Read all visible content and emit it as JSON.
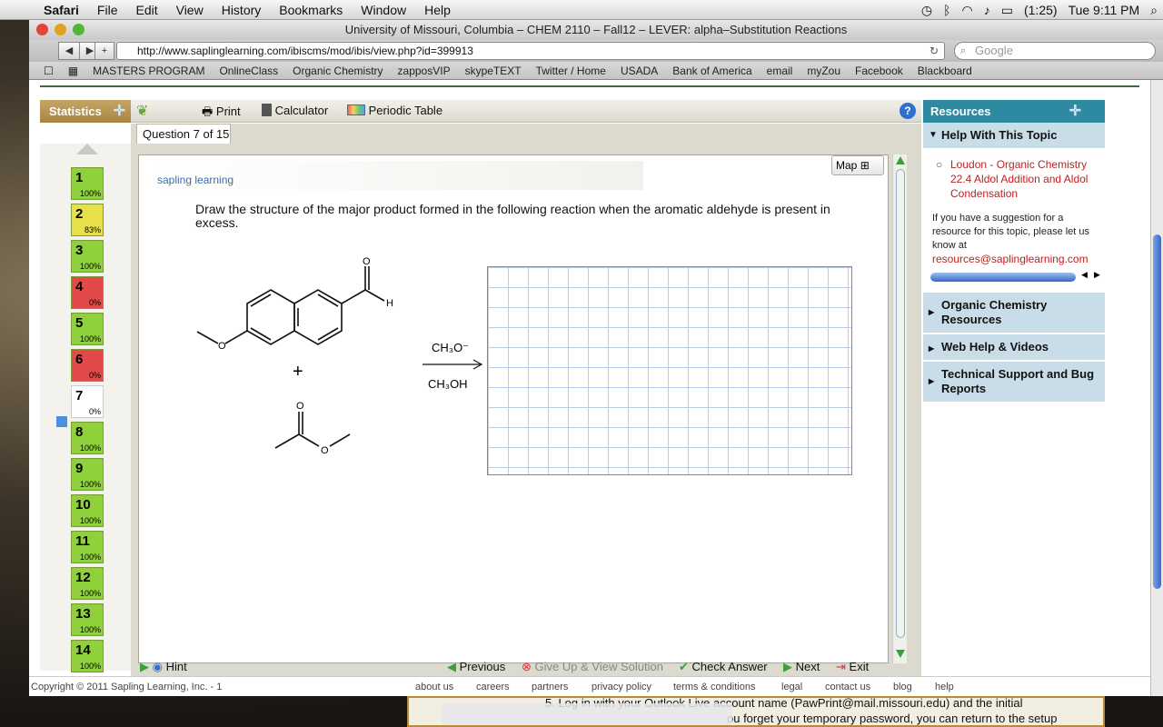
{
  "menubar": {
    "app": "Safari",
    "items": [
      "File",
      "Edit",
      "View",
      "History",
      "Bookmarks",
      "Window",
      "Help"
    ],
    "battery": "(1:25)",
    "clock": "Tue 9:11 PM"
  },
  "window": {
    "title": "University of Missouri, Columbia – CHEM 2110 – Fall12 – LEVER: alpha–Substitution Reactions",
    "url": "http://www.saplinglearning.com/ibiscms/mod/ibis/view.php?id=399913",
    "search_placeholder": "Google"
  },
  "bookmarks": [
    "MASTERS PROGRAM",
    "OnlineClass",
    "Organic Chemistry",
    "zapposVIP",
    "skypeTEXT",
    "Twitter / Home",
    "USADA",
    "Bank of America",
    "email",
    "myZou",
    "Facebook",
    "Blackboard"
  ],
  "app_toolbar": {
    "statistics": "Statistics",
    "print": "Print",
    "calculator": "Calculator",
    "periodic_table": "Periodic Table"
  },
  "question_tab": "Question 7 of 15",
  "questions": [
    {
      "n": "1",
      "pct": "100%",
      "color": "#8ed13a"
    },
    {
      "n": "2",
      "pct": "83%",
      "color": "#e8e04a"
    },
    {
      "n": "3",
      "pct": "100%",
      "color": "#8ed13a"
    },
    {
      "n": "4",
      "pct": "0%",
      "color": "#e24a4a"
    },
    {
      "n": "5",
      "pct": "100%",
      "color": "#8ed13a"
    },
    {
      "n": "6",
      "pct": "0%",
      "color": "#e24a4a"
    },
    {
      "n": "7",
      "pct": "0%",
      "color": "#ffffff"
    },
    {
      "n": "8",
      "pct": "100%",
      "color": "#8ed13a"
    },
    {
      "n": "9",
      "pct": "100%",
      "color": "#8ed13a"
    },
    {
      "n": "10",
      "pct": "100%",
      "color": "#8ed13a"
    },
    {
      "n": "11",
      "pct": "100%",
      "color": "#8ed13a"
    },
    {
      "n": "12",
      "pct": "100%",
      "color": "#8ed13a"
    },
    {
      "n": "13",
      "pct": "100%",
      "color": "#8ed13a"
    },
    {
      "n": "14",
      "pct": "100%",
      "color": "#8ed13a"
    }
  ],
  "content": {
    "logo_text": "sapling learning",
    "map": "Map",
    "question_text": "Draw the structure of the major product formed in the following reaction when the aromatic aldehyde is present in excess.",
    "reagent_top": "CH₃O⁻",
    "reagent_bottom": "CH₃OH",
    "plus": "+",
    "atom_O": "O",
    "atom_H": "H"
  },
  "bottom_actions": {
    "hint": "Hint",
    "previous": "Previous",
    "give_up": "Give Up & View Solution",
    "check": "Check Answer",
    "next": "Next",
    "exit": "Exit"
  },
  "resources": {
    "title": "Resources",
    "help_topic": "Help With This Topic",
    "link": "Loudon - Organic Chemistry 22.4 Aldol Addition and Aldol Condensation",
    "suggestion": "If you have a suggestion for a resource for this topic, please let us know at",
    "email": "resources@saplinglearning.com",
    "sections": [
      "Organic Chemistry Resources",
      "Web Help & Videos",
      "Technical Support and Bug Reports"
    ]
  },
  "footer": {
    "copyright": "Copyright © 2011 Sapling Learning, Inc. - 1",
    "links": [
      "about us",
      "careers",
      "partners",
      "privacy policy",
      "terms & conditions",
      "legal",
      "contact us",
      "blog",
      "help"
    ]
  },
  "background_doc": {
    "line1": "5.  Log in with your Outlook Live account name (PawPrint@mail.missouri.edu) and the initial",
    "line2": "ou forget your temporary password, you can return to the setup"
  },
  "colors": {
    "accent": "#2e8aa0",
    "sapling_tan": "#c6a566"
  }
}
